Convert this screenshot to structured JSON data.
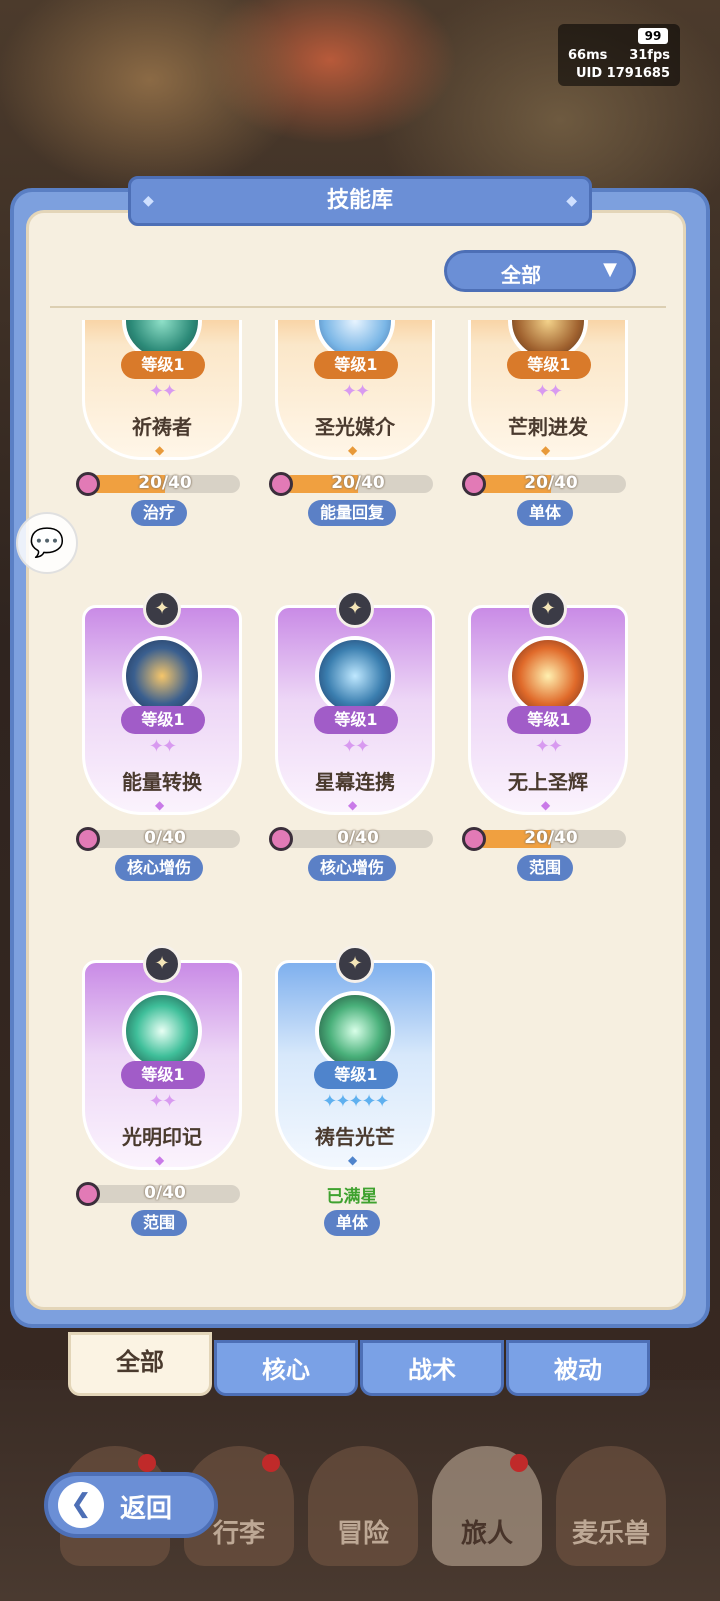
{
  "status": {
    "battery": "99",
    "ping": "66ms",
    "fps": "31fps",
    "uid": "UID  1791685"
  },
  "panel": {
    "title": "技能库",
    "filter_label": "全部",
    "filter_arrow": "▼"
  },
  "cards": [
    {
      "name": "祈祷者",
      "level": "等级1",
      "stars": "✦✦",
      "progress_text": "20/40",
      "progress": 0.5,
      "tag": "治疗",
      "color": "orange",
      "icon": "prayer-icon"
    },
    {
      "name": "圣光媒介",
      "level": "等级1",
      "stars": "✦✦",
      "progress_text": "20/40",
      "progress": 0.5,
      "tag": "能量回复",
      "color": "orange",
      "icon": "holy-light-icon"
    },
    {
      "name": "芒刺进发",
      "level": "等级1",
      "stars": "✦✦",
      "progress_text": "20/40",
      "progress": 0.5,
      "tag": "单体",
      "color": "orange",
      "icon": "thorn-burst-icon"
    },
    {
      "name": "能量转换",
      "level": "等级1",
      "stars": "✦✦",
      "progress_text": "0/40",
      "progress": 0,
      "tag": "核心增伤",
      "color": "purple",
      "icon": "energy-swirl-icon"
    },
    {
      "name": "星幕连携",
      "level": "等级1",
      "stars": "✦✦",
      "progress_text": "0/40",
      "progress": 0,
      "tag": "核心增伤",
      "color": "purple",
      "icon": "galaxy-icon"
    },
    {
      "name": "无上圣辉",
      "level": "等级1",
      "stars": "✦✦",
      "progress_text": "20/40",
      "progress": 0.5,
      "tag": "范围",
      "color": "purple",
      "icon": "explosion-icon"
    },
    {
      "name": "光明印记",
      "level": "等级1",
      "stars": "✦✦",
      "progress_text": "0/40",
      "progress": 0,
      "tag": "范围",
      "color": "purple",
      "icon": "star-burst-icon"
    },
    {
      "name": "祷告光芒",
      "level": "等级1",
      "stars": "✦✦✦✦✦",
      "full_text": "已满星",
      "tag": "单体",
      "color": "blue",
      "icon": "healing-cross-icon"
    }
  ],
  "tabs": [
    "全部",
    "核心",
    "战术",
    "被动"
  ],
  "nav": [
    "行李",
    "冒险",
    "旅人",
    "麦乐兽"
  ],
  "back_label": "返回",
  "colors": {
    "orange": "#f2a24a",
    "purple": "#c98be6",
    "blue": "#7fb0ee",
    "accent": "#6b8fd6"
  }
}
